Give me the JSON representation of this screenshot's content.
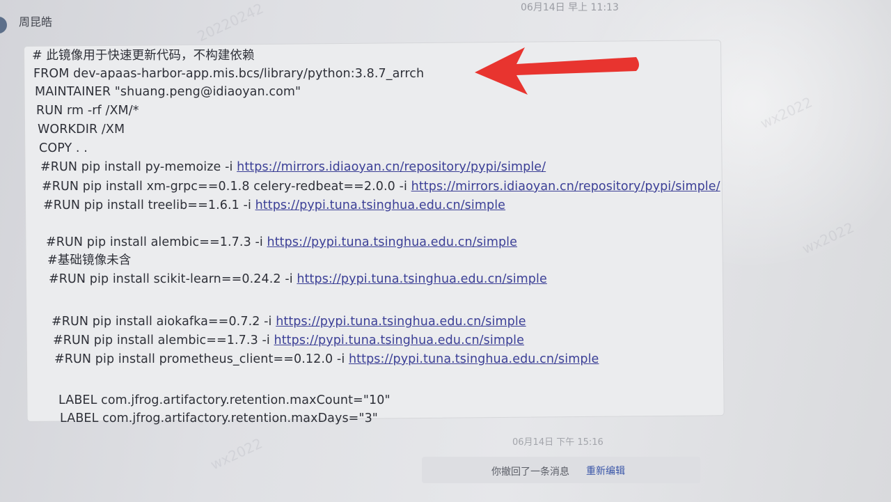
{
  "header": {
    "top_time": "06月14日 早上 11:13"
  },
  "message": {
    "sender": "周昆皓",
    "lines": [
      {
        "text": "# 此镜像用于快速更新代码，不构建依赖"
      },
      {
        "text": "FROM dev-apaas-harbor-app.mis.bcs/library/python:3.8.7_arrch"
      },
      {
        "text": "MAINTAINER \"shuang.peng@idiaoyan.com\""
      },
      {
        "text": "RUN rm -rf /XM/*"
      },
      {
        "text": "WORKDIR /XM"
      },
      {
        "text": "COPY . ."
      },
      {
        "text": "#RUN pip install py-memoize -i ",
        "url": "https://mirrors.idiaoyan.cn/repository/pypi/simple/"
      },
      {
        "text": "#RUN pip install xm-grpc==0.1.8 celery-redbeat==2.0.0 -i ",
        "url": "https://mirrors.idiaoyan.cn/repository/pypi/simple/"
      },
      {
        "text": "#RUN pip install treelib==1.6.1 -i ",
        "url": "https://pypi.tuna.tsinghua.edu.cn/simple"
      },
      {
        "text": "#RUN pip install alembic==1.7.3 -i ",
        "url": "https://pypi.tuna.tsinghua.edu.cn/simple"
      },
      {
        "text": "#基础镜像未含"
      },
      {
        "text": "#RUN pip install scikit-learn==0.24.2 -i ",
        "url": "https://pypi.tuna.tsinghua.edu.cn/simple"
      },
      {
        "text": "#RUN pip install aiokafka==0.7.2 -i ",
        "url": "https://pypi.tuna.tsinghua.edu.cn/simple"
      },
      {
        "text": "#RUN pip install alembic==1.7.3 -i ",
        "url": "https://pypi.tuna.tsinghua.edu.cn/simple"
      },
      {
        "text": "#RUN pip install prometheus_client==0.12.0 -i ",
        "url": "https://pypi.tuna.tsinghua.edu.cn/simple"
      },
      {
        "text": "LABEL com.jfrog.artifactory.retention.maxCount=\"10\""
      },
      {
        "text": "LABEL com.jfrog.artifactory.retention.maxDays=\"3\""
      }
    ],
    "time": "06月14日 下午 15:16"
  },
  "recall": {
    "text": "你撤回了一条消息",
    "reedit_label": "重新编辑"
  },
  "colors": {
    "link": "#3b3f96",
    "arrow": "#e8342f"
  },
  "icons": {
    "annotation": "red-arrow-icon"
  }
}
